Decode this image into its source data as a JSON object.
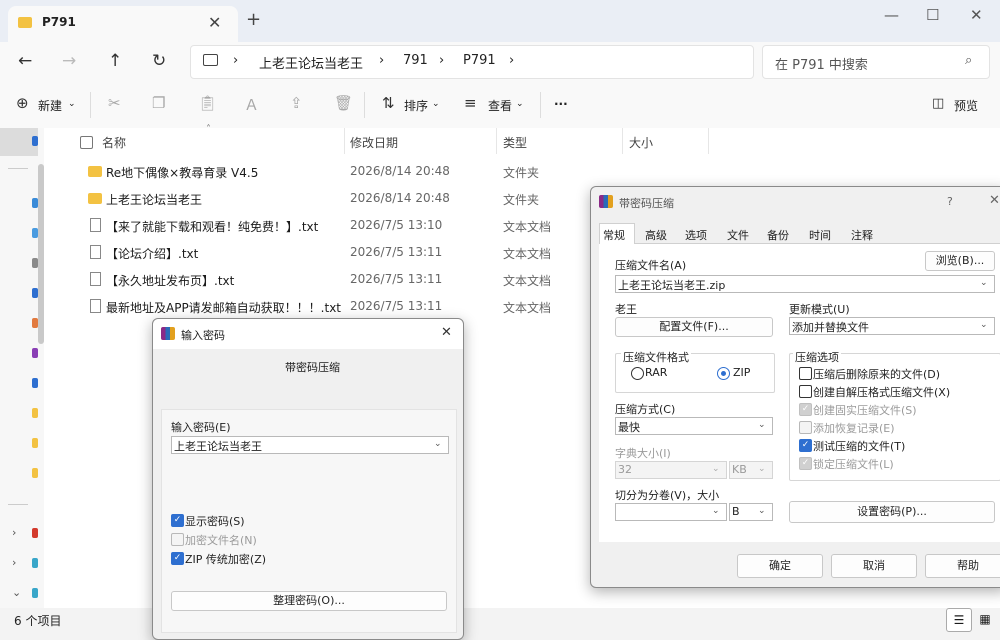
{
  "explorer": {
    "tab_title": "P791",
    "breadcrumb": [
      "上老王论坛当老王",
      "791",
      "P791"
    ],
    "search_placeholder": "在 P791 中搜索",
    "commands": {
      "new": "新建",
      "sort": "排序",
      "view": "查看",
      "more": "···",
      "preview": "预览"
    },
    "columns": {
      "name": "名称",
      "modified": "修改日期",
      "type": "类型",
      "size": "大小"
    },
    "files": [
      {
        "name": "Re地下偶像×教尋育录 V4.5",
        "date": "2026/8/14 20:48",
        "type": "文件夹",
        "kind": "folder"
      },
      {
        "name": "上老王论坛当老王",
        "date": "2026/8/14 20:48",
        "type": "文件夹",
        "kind": "folder"
      },
      {
        "name": "【来了就能下载和观看！纯免费！】.txt",
        "date": "2026/7/5 13:10",
        "type": "文本文档",
        "kind": "text"
      },
      {
        "name": "【论坛介绍】.txt",
        "date": "2026/7/5 13:11",
        "type": "文本文档",
        "kind": "text"
      },
      {
        "name": "【永久地址发布页】.txt",
        "date": "2026/7/5 13:11",
        "type": "文本文档",
        "kind": "text"
      },
      {
        "name": "最新地址及APP请发邮箱自动获取！！！.txt",
        "date": "2026/7/5 13:11",
        "type": "文本文档",
        "kind": "text"
      }
    ],
    "status": "6 个项目"
  },
  "password_dialog": {
    "title": "输入密码",
    "subtitle": "带密码压缩",
    "label": "输入密码(E)",
    "value": "上老王论坛当老王",
    "show_password": "显示密码(S)",
    "encrypt_names": "加密文件名(N)",
    "zip_legacy": "ZIP 传统加密(Z)",
    "organize": "整理密码(O)..."
  },
  "archive_dialog": {
    "title": "带密码压缩",
    "help": "?",
    "tabs": [
      "常规",
      "高级",
      "选项",
      "文件",
      "备份",
      "时间",
      "注释"
    ],
    "archive_name_label": "压缩文件名(A)",
    "browse": "浏览(B)...",
    "archive_name": "上老王论坛当老王.zip",
    "profile_label": "老王",
    "profile_button": "配置文件(F)...",
    "update_mode_label": "更新模式(U)",
    "update_mode": "添加并替换文件",
    "format_label": "压缩文件格式",
    "format_rar": "RAR",
    "format_zip": "ZIP",
    "options_label": "压缩选项",
    "options": [
      {
        "label": "压缩后删除原来的文件(D)",
        "state": "off"
      },
      {
        "label": "创建自解压格式压缩文件(X)",
        "state": "off"
      },
      {
        "label": "创建固实压缩文件(S)",
        "state": "ondis"
      },
      {
        "label": "添加恢复记录(E)",
        "state": "dis"
      },
      {
        "label": "测试压缩的文件(T)",
        "state": "on"
      },
      {
        "label": "锁定压缩文件(L)",
        "state": "ondis"
      }
    ],
    "method_label": "压缩方式(C)",
    "method": "最快",
    "dict_label": "字典大小(I)",
    "dict_value": "32",
    "dict_unit": "KB",
    "split_label": "切分为分卷(V)，大小",
    "split_unit": "B",
    "set_password": "设置密码(P)...",
    "ok": "确定",
    "cancel": "取消",
    "help_button": "帮助"
  }
}
